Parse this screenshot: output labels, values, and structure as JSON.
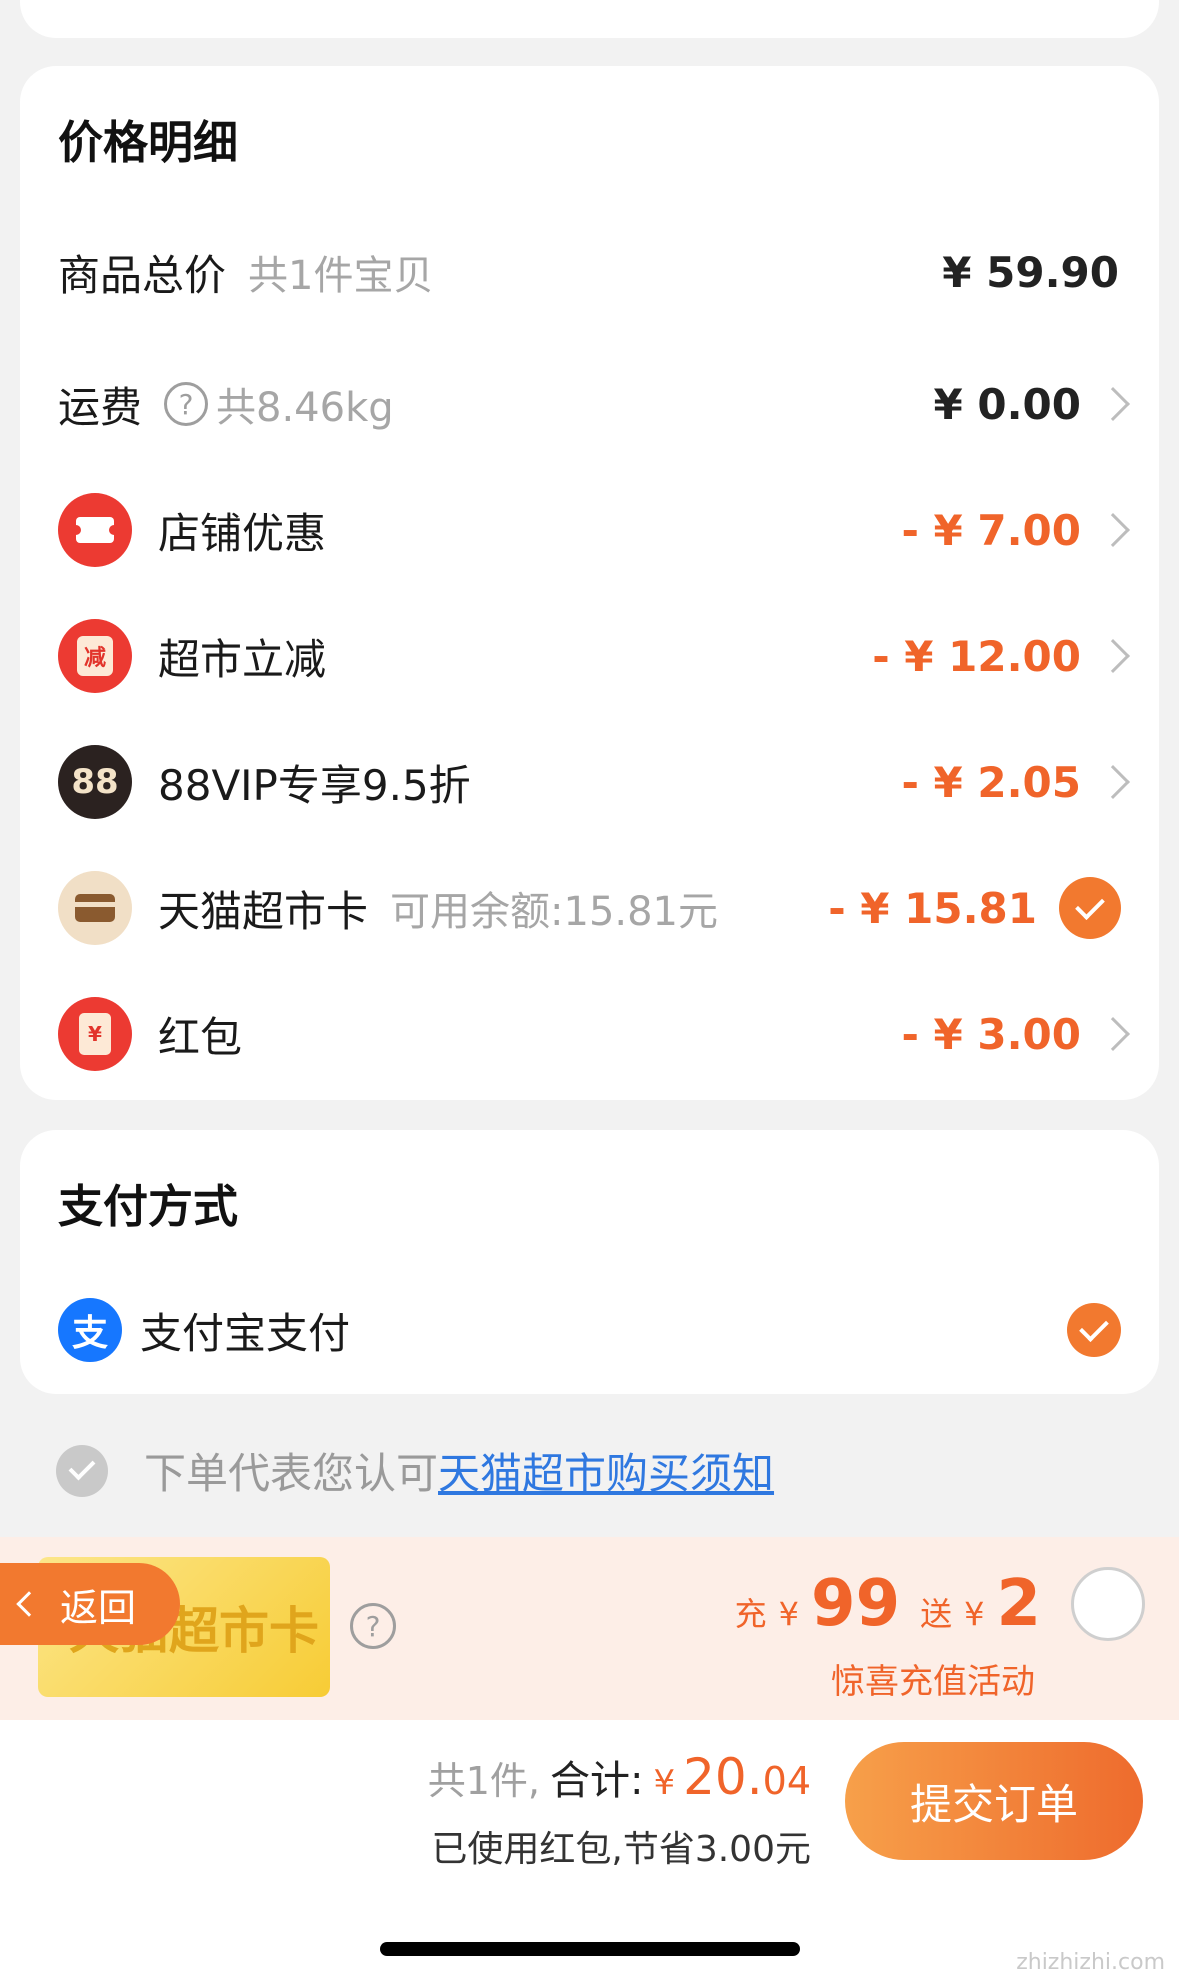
{
  "price": {
    "title": "价格明细",
    "total": {
      "label": "商品总价",
      "sub": "共1件宝贝",
      "amount": "¥ 59.90"
    },
    "shipping": {
      "label": "运费",
      "help": "?",
      "sub": "共8.46kg",
      "amount": "¥ 0.00"
    },
    "items": [
      {
        "icon": "coupon-icon",
        "label": "店铺优惠",
        "amount": "- ¥ 7.00"
      },
      {
        "icon": "discount-badge-icon",
        "icon_text": "减",
        "label": "超市立减",
        "amount": "- ¥ 12.00"
      },
      {
        "icon": "88vip-icon",
        "icon_text": "88",
        "label": "88VIP专享9.5折",
        "amount": "- ¥ 2.05"
      },
      {
        "icon": "store-card-icon",
        "label": "天猫超市卡",
        "sub": "可用余额:15.81元",
        "amount": "- ¥ 15.81",
        "checked": true
      },
      {
        "icon": "red-packet-icon",
        "icon_text": "¥",
        "label": "红包",
        "amount": "- ¥ 3.00"
      }
    ]
  },
  "payment": {
    "title": "支付方式",
    "method": "支付宝支付",
    "icon_text": "支",
    "checked": true
  },
  "agreement": {
    "text": "下单代表您认可",
    "link": "天猫超市购买须知"
  },
  "promo": {
    "card_text": "天猫超市卡",
    "help": "?",
    "charge_label": "充",
    "yen": "¥",
    "charge_amount": "99",
    "gift_label": "送",
    "gift_amount": "2",
    "subtitle": "惊喜充值活动"
  },
  "back": {
    "label": "返回"
  },
  "footer": {
    "count": "共1件,",
    "total_label": "合计:",
    "yen": "¥",
    "total_int": "20.",
    "total_dec": "04",
    "savings": "已使用红包,节省3.00元",
    "submit": "提交订单"
  },
  "watermark": "zhizhizhi.com",
  "colors": {
    "accent": "#f0642a",
    "check": "#f2792f",
    "alipay": "#1677ff",
    "link": "#2f78e0"
  }
}
